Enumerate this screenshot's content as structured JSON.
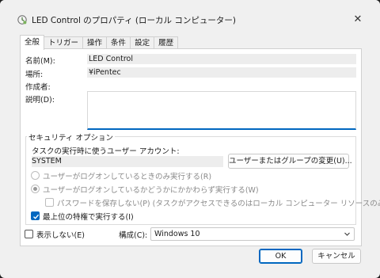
{
  "window": {
    "title": "LED Control のプロパティ (ローカル コンピューター)",
    "close_glyph": "✕"
  },
  "tabs": [
    {
      "label": "全般",
      "active": true
    },
    {
      "label": "トリガー",
      "active": false
    },
    {
      "label": "操作",
      "active": false
    },
    {
      "label": "条件",
      "active": false
    },
    {
      "label": "設定",
      "active": false
    },
    {
      "label": "履歴",
      "active": false
    }
  ],
  "general": {
    "name_label": "名前(M):",
    "name_value": "LED Control",
    "location_label": "場所:",
    "location_value": "¥iPentec",
    "author_label": "作成者:",
    "author_value": "",
    "description_label": "説明(D):",
    "description_value": ""
  },
  "security": {
    "legend": "セキュリティ オプション",
    "account_label": "タスクの実行時に使うユーザー アカウント:",
    "account_value": "SYSTEM",
    "change_button": "ユーザーまたはグループの変更(U)...",
    "radio_logged_on": "ユーザーがログオンしているときのみ実行する(R)",
    "radio_whether": "ユーザーがログオンしているかどうかにかかわらず実行する(W)",
    "no_store_password": "パスワードを保存しない(P) (タスクがアクセスできるのはローカル コンピューター リソースのみ)",
    "highest_privileges": "最上位の特権で実行する(I)"
  },
  "footer": {
    "hidden_label": "表示しない(E)",
    "configure_label": "構成(C):",
    "configure_value": "Windows 10",
    "ok_button": "OK",
    "cancel_button": "キャンセル"
  },
  "colors": {
    "accent": "#0067c0",
    "window_bg": "#f0f0f0",
    "panel_bg": "#ffffff"
  },
  "icons": {
    "title": "clock-icon",
    "close": "close-icon",
    "dropdown": "chevron-down-icon",
    "checkmark": "checkmark-icon"
  }
}
